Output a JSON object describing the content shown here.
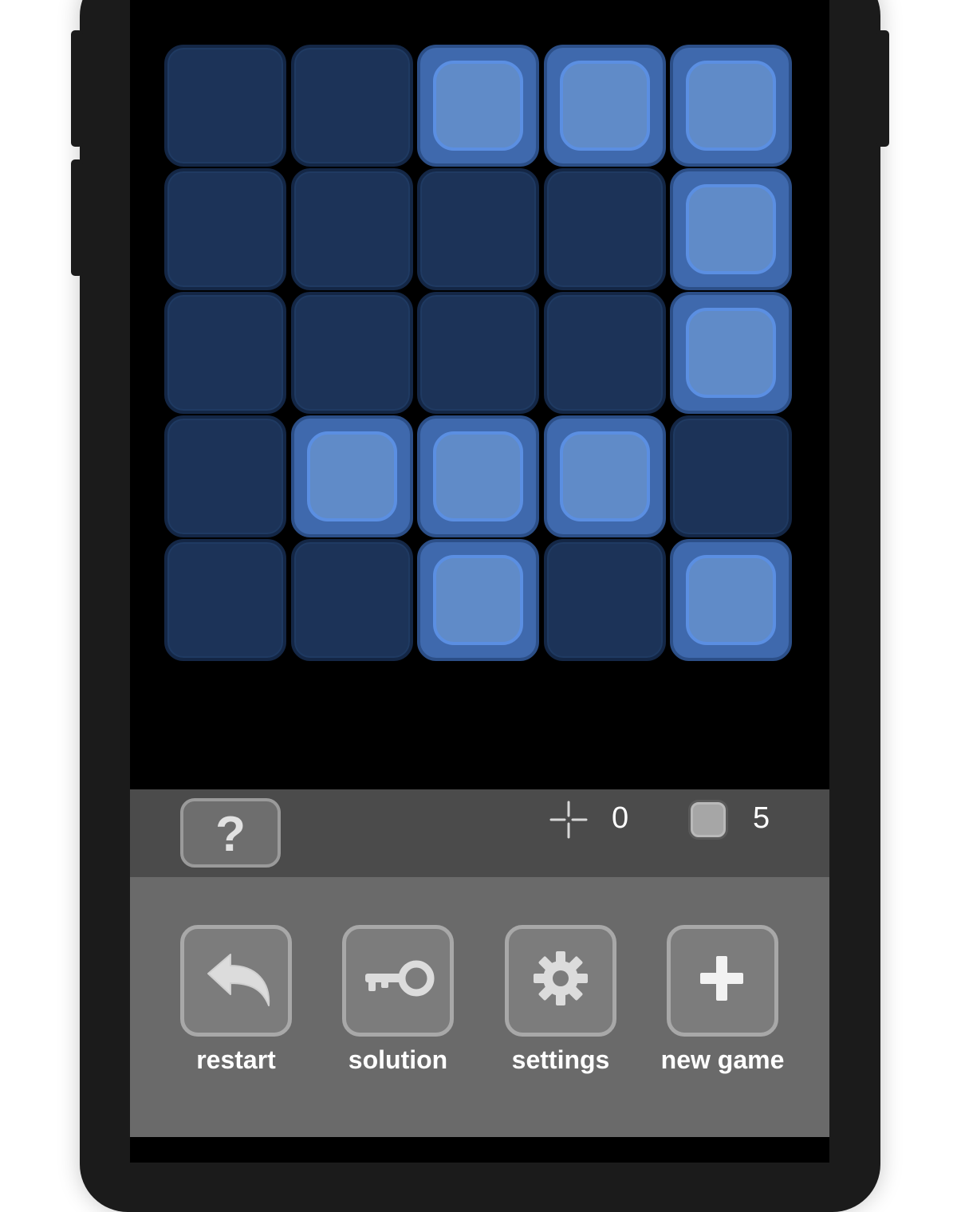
{
  "board": {
    "rows": 5,
    "cols": 5,
    "cells": [
      [
        0,
        0,
        1,
        1,
        1
      ],
      [
        0,
        0,
        0,
        0,
        1
      ],
      [
        0,
        0,
        0,
        0,
        1
      ],
      [
        0,
        1,
        1,
        1,
        0
      ],
      [
        0,
        0,
        1,
        0,
        1
      ]
    ]
  },
  "status": {
    "help_label": "?",
    "moves_icon": "crosshair-icon",
    "moves_count": "0",
    "lights_icon": "light-square-icon",
    "lights_count": "5"
  },
  "toolbar": {
    "restart_label": "restart",
    "restart_icon": "undo-arrow-icon",
    "solution_label": "solution",
    "solution_icon": "key-icon",
    "settings_label": "settings",
    "settings_icon": "gear-icon",
    "new_game_label": "new game",
    "new_game_icon": "plus-icon"
  },
  "colors": {
    "cell_off": "#1c3358",
    "cell_on": "#3f69ad",
    "cell_on_inner": "#608bc8",
    "status_bar": "#4b4b4b",
    "toolbar": "#6a6a6a"
  }
}
